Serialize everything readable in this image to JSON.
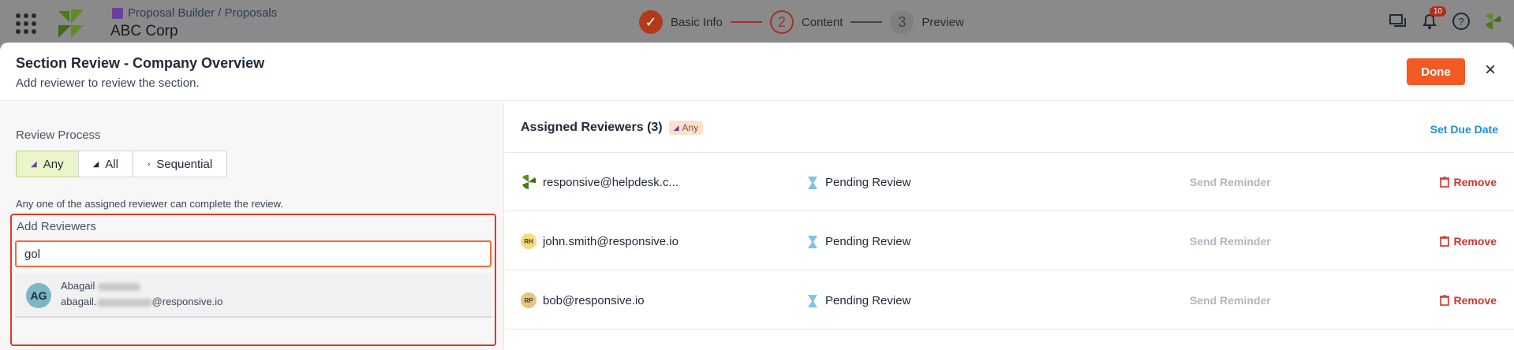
{
  "topbar": {
    "breadcrumb": "Proposal Builder / Proposals",
    "company": "ABC Corp",
    "steps": [
      {
        "number": "✓",
        "label": "Basic Info",
        "state": "done"
      },
      {
        "number": "2",
        "label": "Content",
        "state": "active"
      },
      {
        "number": "3",
        "label": "Preview",
        "state": "todo"
      }
    ],
    "notifications_count": "10"
  },
  "modal": {
    "title": "Section Review - Company Overview",
    "subtitle": "Add reviewer to review the section.",
    "done_label": "Done",
    "close_glyph": "×"
  },
  "review_process": {
    "label": "Review Process",
    "options": [
      {
        "label": "Any",
        "selected": true
      },
      {
        "label": "All",
        "selected": false
      },
      {
        "label": "Sequential",
        "selected": false
      }
    ],
    "description": "Any one of the assigned reviewer can complete the review."
  },
  "add_reviewers": {
    "label": "Add Reviewers",
    "search_value": "gol",
    "suggestion": {
      "initials": "AG",
      "name_visible": "Abagail",
      "email_prefix": "abagail.",
      "email_suffix": "@responsive.io"
    }
  },
  "assigned": {
    "title": "Assigned Reviewers (3)",
    "mode_tag": "Any",
    "set_due_label": "Set Due Date",
    "reviewers": [
      {
        "avatar": "logo",
        "initials": "",
        "email": "responsive@helpdesk.c...",
        "status": "Pending Review",
        "reminder": "Send Reminder",
        "remove": "Remove"
      },
      {
        "avatar": "y",
        "initials": "RH",
        "email": "john.smith@responsive.io",
        "status": "Pending Review",
        "reminder": "Send Reminder",
        "remove": "Remove"
      },
      {
        "avatar": "o",
        "initials": "RP",
        "email": "bob@responsive.io",
        "status": "Pending Review",
        "reminder": "Send Reminder",
        "remove": "Remove"
      }
    ]
  },
  "colors": {
    "accent": "#f15a22",
    "link": "#1a8fd8",
    "danger": "#d0352a",
    "selected_bg": "#eaf6c9"
  }
}
